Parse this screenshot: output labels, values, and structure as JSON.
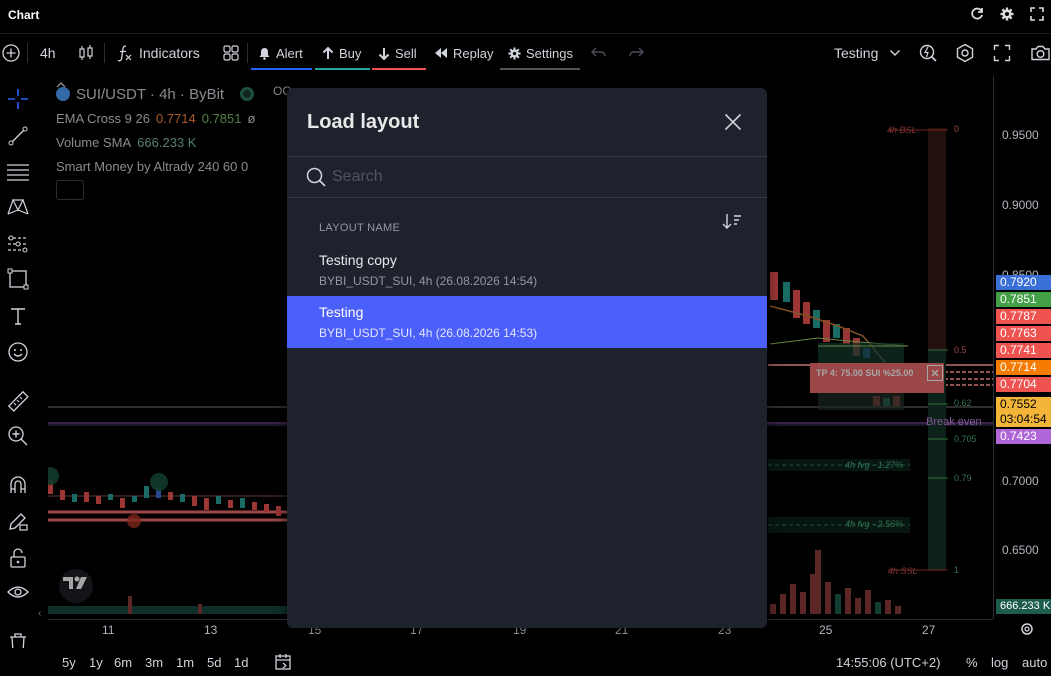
{
  "titlebar": {
    "title": "Chart"
  },
  "toolbar": {
    "interval": "4h",
    "indicators_label": "Indicators",
    "alert_label": "Alert",
    "buy_label": "Buy",
    "sell_label": "Sell",
    "replay_label": "Replay",
    "settings_label": "Settings",
    "layout_name": "Testing"
  },
  "legend": {
    "symbol": "SUI/USDT · 4h · ByBit",
    "ema_name": "EMA Cross 9 26",
    "ema_value_1": "0.7714",
    "ema_value_2": "0.7851",
    "ema_extra": "ø",
    "volume_name": "Volume SMA",
    "volume_value": "666.233 K",
    "smc_name": "Smart Money by Altrady 240 60 0",
    "obscured_fragment": "OC"
  },
  "price_scale": {
    "ticks": [
      "0.9500",
      "0.9000",
      "0.8500",
      "0.7000",
      "0.6500"
    ],
    "labels": [
      {
        "text": "0.7920",
        "color": "#3a6fd8"
      },
      {
        "text": "0.7851",
        "color": "#43a047"
      },
      {
        "text": "0.7787",
        "color": "#ef5350"
      },
      {
        "text": "0.7763",
        "color": "#ef5350"
      },
      {
        "text": "0.7741",
        "color": "#ef5350"
      },
      {
        "text": "0.7714",
        "color": "#f57c00"
      },
      {
        "text": "0.7704",
        "color": "#ef5350"
      }
    ],
    "current_price": "0.7552",
    "countdown": "03:04:54",
    "break_even_price": "0.7423",
    "volume_label": "666.233 K"
  },
  "chart_annotations": {
    "bsl": "4h BSL",
    "ssl": "4h SSL",
    "fvg1": "4h fvg - 1.27%",
    "fvg2": "4h fvg - 2.56%",
    "break_even": "Break even",
    "tp": "TP 4: 75.00 SUI %25.00",
    "fib": [
      "0",
      "0.5",
      "0.62",
      "0.705",
      "0.79",
      "1"
    ]
  },
  "time_axis": {
    "labels": [
      "11",
      "13",
      "15",
      "17",
      "19",
      "21",
      "23",
      "25",
      "27"
    ]
  },
  "bottombar": {
    "ranges": [
      "5y",
      "1y",
      "6m",
      "3m",
      "1m",
      "5d",
      "1d"
    ],
    "clock": "14:55:06 (UTC+2)",
    "percent": "%",
    "log": "log",
    "auto": "auto"
  },
  "modal": {
    "title": "Load layout",
    "search_placeholder": "Search",
    "column_header": "LAYOUT NAME",
    "items": [
      {
        "name": "Testing copy",
        "meta": "BYBI_USDT_SUI, 4h (26.08.2026 14:54)"
      },
      {
        "name": "Testing",
        "meta": "BYBI_USDT_SUI, 4h (26.08.2026 14:53)"
      }
    ]
  },
  "colors": {
    "accent": "#4b5ffa",
    "modal_bg": "#1e222d",
    "bull": "#26a69a",
    "bear": "#ef5350"
  }
}
